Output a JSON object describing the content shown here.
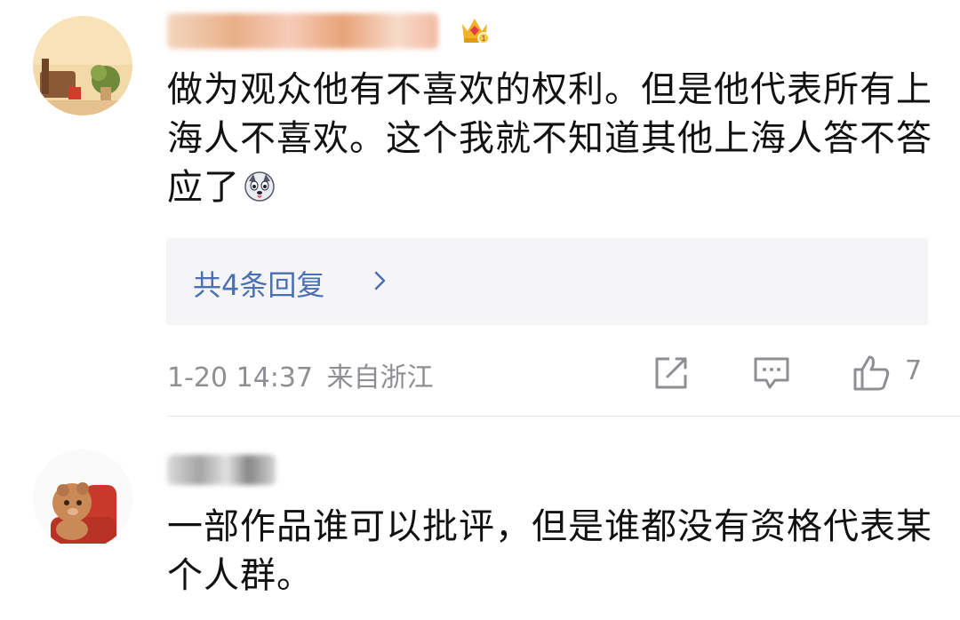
{
  "comments": [
    {
      "text": "做为观众他有不喜欢的权利。但是他代表所有上海人不喜欢。这个我就不知道其他上海人答不答应了",
      "reply_count_label": "共4条回复",
      "timestamp": "1-20 14:37",
      "location": "来自浙江",
      "like_count": "7"
    },
    {
      "text": "一部作品谁可以批评，但是谁都没有资格代表某个人群。"
    }
  ],
  "icons": {
    "badge": "crown-badge-icon",
    "emoji": "husky-emoji-icon",
    "share": "share-icon",
    "comment": "comment-icon",
    "like": "thumbs-up-icon",
    "chevron": "chevron-right-icon"
  },
  "colors": {
    "link": "#4a6fb3",
    "meta": "#8e8e93",
    "reply_bg": "#f5f5f7"
  }
}
